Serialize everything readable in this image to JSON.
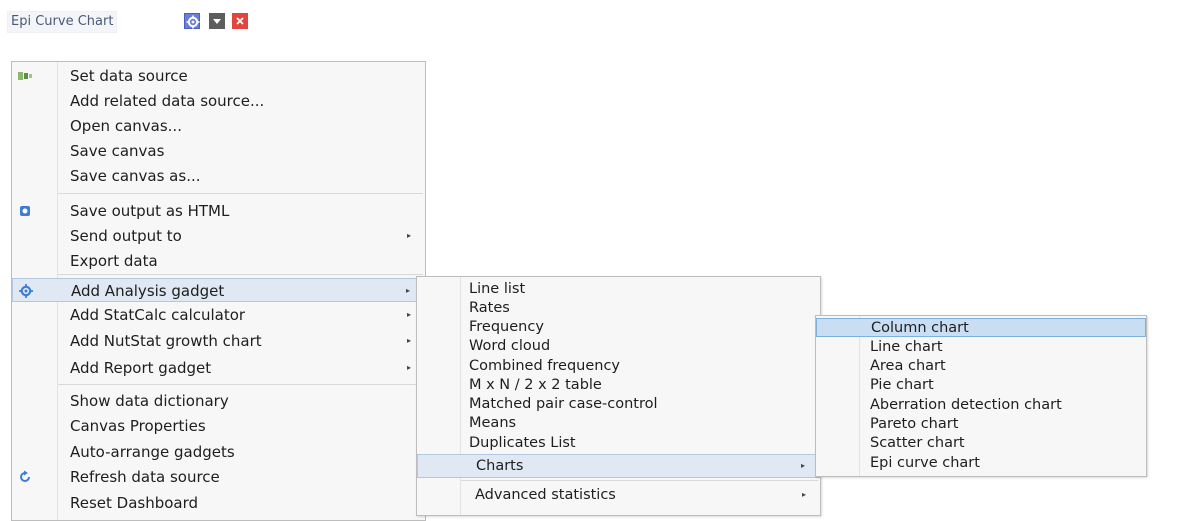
{
  "gadget": {
    "title": "Epi Curve Chart",
    "buttons": [
      {
        "name": "settings",
        "icon": "gear-icon",
        "color": "#6b7fd8"
      },
      {
        "name": "collapse",
        "icon": "triangle-down-icon",
        "color": "#5d5d5d"
      },
      {
        "name": "close",
        "icon": "close-icon",
        "color": "#e0463c"
      }
    ]
  },
  "main_menu": {
    "items": [
      {
        "label": "Set data source",
        "icon": "data-source-icon"
      },
      {
        "label": "Add related data source..."
      },
      {
        "label": "Open canvas..."
      },
      {
        "label": "Save canvas"
      },
      {
        "label": "Save canvas as..."
      },
      {
        "label": "Save output as HTML",
        "icon": "html-export-icon"
      },
      {
        "label": "Send output to",
        "submenu": true
      },
      {
        "label": "Export data"
      },
      {
        "label": "Add Analysis gadget",
        "icon": "gear-icon",
        "submenu": true,
        "highlighted": true
      },
      {
        "label": "Add StatCalc calculator",
        "submenu": true
      },
      {
        "label": "Add NutStat growth chart",
        "submenu": true
      },
      {
        "label": "Add Report gadget",
        "submenu": true
      },
      {
        "label": "Show data dictionary"
      },
      {
        "label": "Canvas Properties"
      },
      {
        "label": "Auto-arrange gadgets"
      },
      {
        "label": "Refresh data source",
        "icon": "refresh-icon"
      },
      {
        "label": "Reset Dashboard"
      }
    ]
  },
  "analysis_submenu": {
    "items": [
      {
        "label": "Line list"
      },
      {
        "label": "Rates"
      },
      {
        "label": "Frequency"
      },
      {
        "label": "Word cloud"
      },
      {
        "label": "Combined frequency"
      },
      {
        "label": "M x N / 2 x 2 table"
      },
      {
        "label": "Matched pair case-control"
      },
      {
        "label": "Means"
      },
      {
        "label": "Duplicates List"
      },
      {
        "label": "Charts",
        "submenu": true,
        "highlighted": true
      },
      {
        "label": "Advanced statistics",
        "submenu": true
      }
    ]
  },
  "charts_submenu": {
    "items": [
      {
        "label": "Column chart",
        "highlighted": true
      },
      {
        "label": "Line chart"
      },
      {
        "label": "Area chart"
      },
      {
        "label": "Pie chart"
      },
      {
        "label": "Aberration detection chart"
      },
      {
        "label": "Pareto chart"
      },
      {
        "label": "Scatter chart"
      },
      {
        "label": "Epi curve chart"
      }
    ]
  },
  "submenu_arrow": "▸",
  "colors": {
    "highlight": "#dfe8f3",
    "highlight_border": "#b0c8e2",
    "selected": "#c9def2",
    "selected_border": "#7fb0dd"
  }
}
